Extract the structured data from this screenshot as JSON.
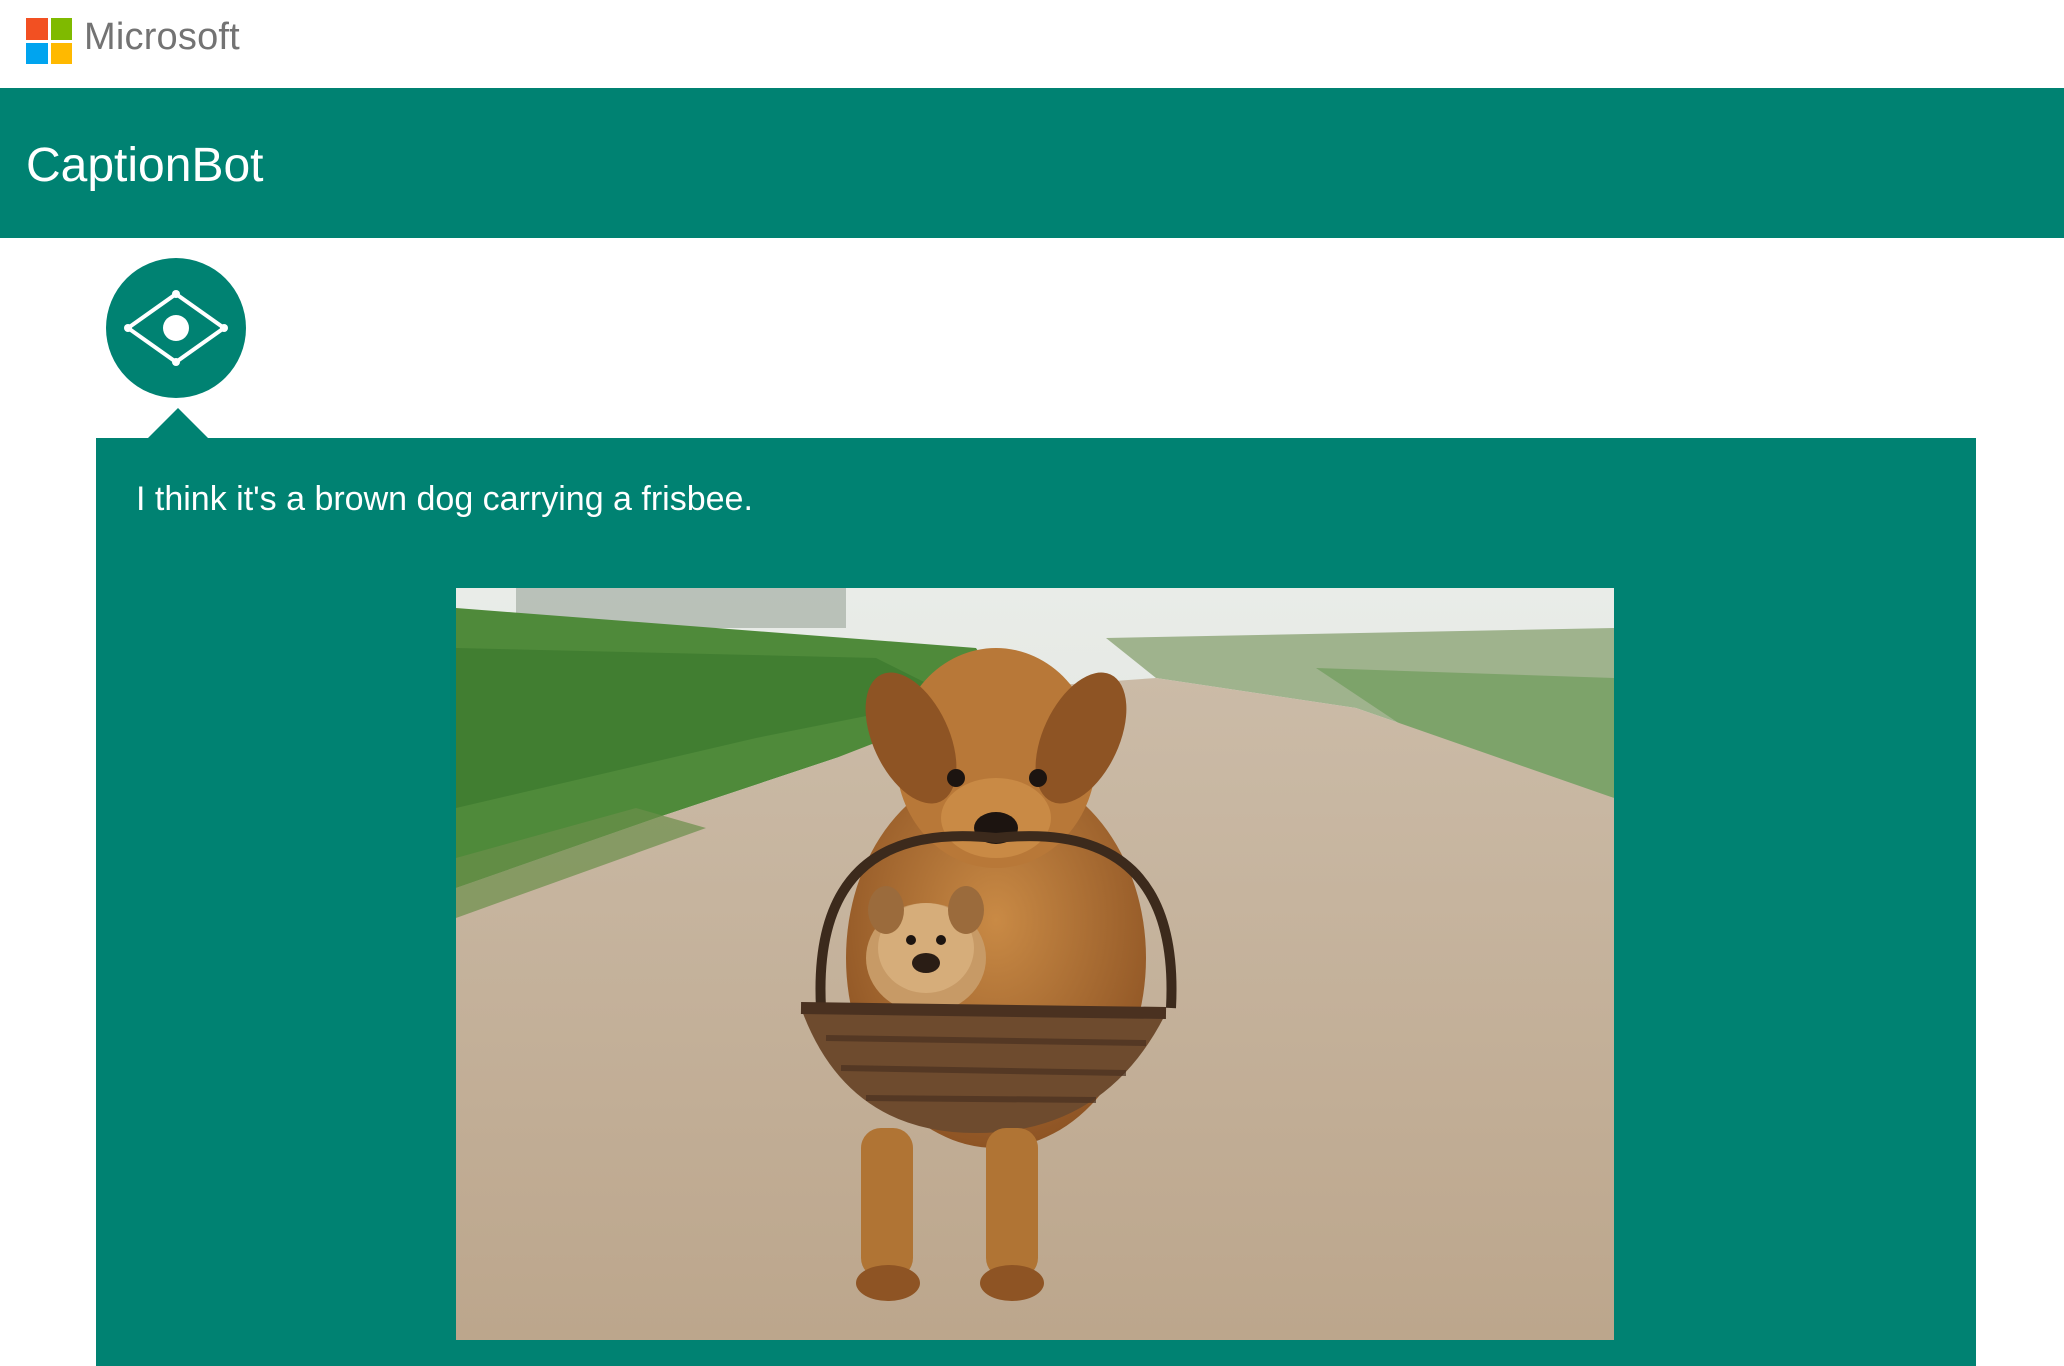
{
  "brand": {
    "name": "Microsoft",
    "logo_colors": [
      "#f25022",
      "#7fba00",
      "#00a4ef",
      "#ffb900"
    ]
  },
  "header": {
    "title": "CaptionBot",
    "background": "#008272"
  },
  "bot": {
    "avatar_icon": "eye-diamond-icon"
  },
  "message": {
    "caption": "I think it's a brown dog carrying a frisbee.",
    "background": "#008272",
    "photo": {
      "subject": "golden retriever carrying a basket with a puppy on a dirt road"
    }
  }
}
